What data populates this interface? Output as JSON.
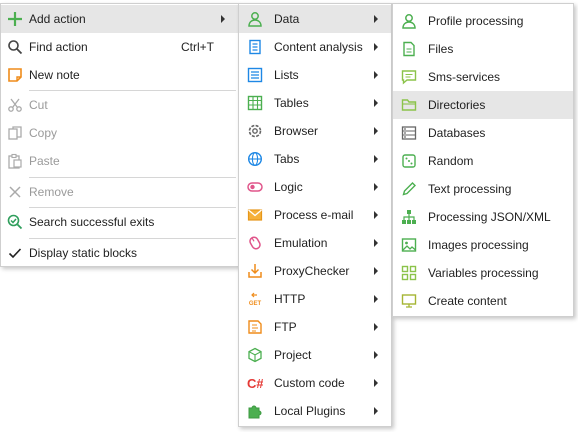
{
  "menu1": {
    "items": [
      {
        "label": "Add action",
        "shortcut": "",
        "submenu": true,
        "highlighted": true,
        "disabled": false,
        "icon": "plus-icon"
      },
      {
        "label": "Find action",
        "shortcut": "Ctrl+T",
        "submenu": false,
        "highlighted": false,
        "disabled": false,
        "icon": "search-icon"
      },
      {
        "label": "New note",
        "shortcut": "",
        "submenu": false,
        "highlighted": false,
        "disabled": false,
        "icon": "note-icon"
      },
      {
        "label": "Cut",
        "shortcut": "",
        "submenu": false,
        "highlighted": false,
        "disabled": true,
        "icon": "scissors-icon"
      },
      {
        "label": "Copy",
        "shortcut": "",
        "submenu": false,
        "highlighted": false,
        "disabled": true,
        "icon": "copy-icon"
      },
      {
        "label": "Paste",
        "shortcut": "",
        "submenu": false,
        "highlighted": false,
        "disabled": true,
        "icon": "paste-icon"
      },
      {
        "label": "Remove",
        "shortcut": "",
        "submenu": false,
        "highlighted": false,
        "disabled": true,
        "icon": "close-icon"
      },
      {
        "label": "Search successful exits",
        "shortcut": "",
        "submenu": false,
        "highlighted": false,
        "disabled": false,
        "icon": "search-check-icon"
      },
      {
        "label": "Display static blocks",
        "shortcut": "",
        "submenu": false,
        "highlighted": false,
        "disabled": false,
        "icon": "checkmark-icon"
      }
    ]
  },
  "menu2": {
    "items": [
      {
        "label": "Data",
        "icon": "user-icon",
        "highlighted": true
      },
      {
        "label": "Content analysis",
        "icon": "document-list-icon"
      },
      {
        "label": "Lists",
        "icon": "list-icon"
      },
      {
        "label": "Tables",
        "icon": "table-icon"
      },
      {
        "label": "Browser",
        "icon": "gear-icon"
      },
      {
        "label": "Tabs",
        "icon": "globe-icon"
      },
      {
        "label": "Logic",
        "icon": "toggle-icon"
      },
      {
        "label": "Process e-mail",
        "icon": "envelope-icon"
      },
      {
        "label": "Emulation",
        "icon": "mouse-icon"
      },
      {
        "label": "ProxyChecker",
        "icon": "proxy-download-icon"
      },
      {
        "label": "HTTP",
        "icon": "http-get-icon"
      },
      {
        "label": "FTP",
        "icon": "ftp-icon"
      },
      {
        "label": "Project",
        "icon": "cube-icon"
      },
      {
        "label": "Custom code",
        "icon": "csharp-icon"
      },
      {
        "label": "Local Plugins",
        "icon": "puzzle-icon"
      }
    ]
  },
  "menu3": {
    "items": [
      {
        "label": "Profile processing",
        "icon": "profile-icon"
      },
      {
        "label": "Files",
        "icon": "file-icon"
      },
      {
        "label": "Sms-services",
        "icon": "sms-icon"
      },
      {
        "label": "Directories",
        "icon": "folder-icon",
        "highlighted": true
      },
      {
        "label": "Databases",
        "icon": "database-icon"
      },
      {
        "label": "Random",
        "icon": "dice-icon"
      },
      {
        "label": "Text processing",
        "icon": "pencil-icon"
      },
      {
        "label": "Processing JSON/XML",
        "icon": "tree-icon"
      },
      {
        "label": "Images processing",
        "icon": "image-icon"
      },
      {
        "label": "Variables processing",
        "icon": "variables-icon"
      },
      {
        "label": "Create content",
        "icon": "monitor-icon"
      }
    ]
  },
  "colors": {
    "green": "#4caf50",
    "orange": "#ef8c1a",
    "red": "#e53935",
    "blue": "#1e88e5",
    "pink": "#e0558a",
    "gray": "#8e8e8e",
    "highlight": "#e6e6e6"
  }
}
